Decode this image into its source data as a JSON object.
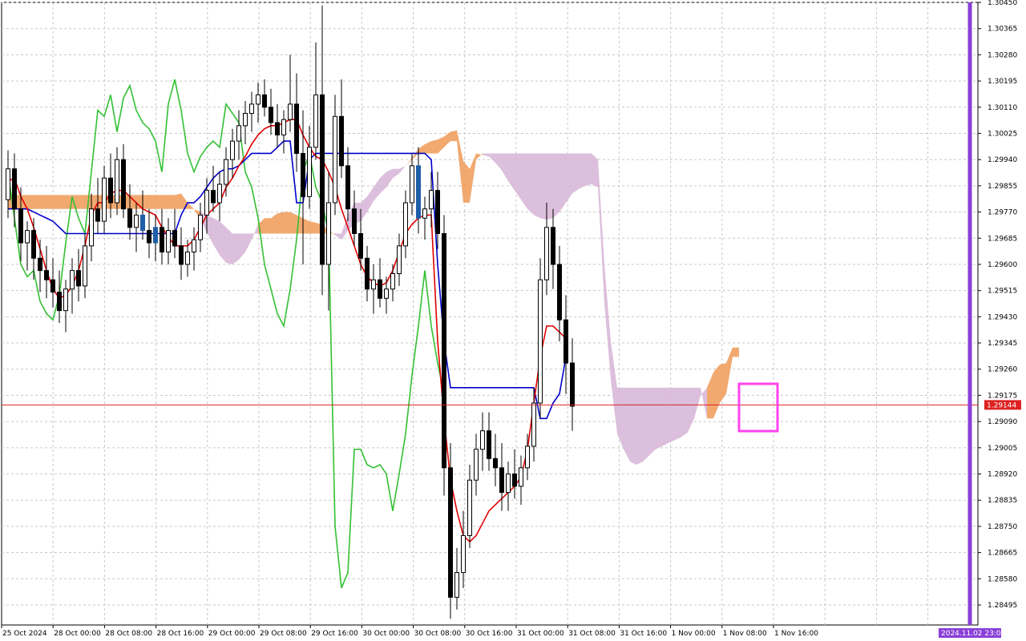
{
  "chart_data": {
    "type": "candlestick",
    "indicator": "ichimoku",
    "ylim": [
      1.2843,
      1.3045
    ],
    "y_ticks": [
      "1.30450",
      "1.30365",
      "1.30280",
      "1.30195",
      "1.30110",
      "1.30025",
      "1.29940",
      "1.29855",
      "1.29770",
      "1.29685",
      "1.29600",
      "1.29515",
      "1.29430",
      "1.29345",
      "1.29260",
      "1.29175",
      "1.29090",
      "1.29005",
      "1.28920",
      "1.28835",
      "1.28750",
      "1.28665",
      "1.28580",
      "1.28495"
    ],
    "x_ticks": [
      "25 Oct 2024",
      "28 Oct 00:00",
      "28 Oct 08:00",
      "28 Oct 16:00",
      "29 Oct 00:00",
      "29 Oct 08:00",
      "29 Oct 16:00",
      "30 Oct 00:00",
      "30 Oct 08:00",
      "30 Oct 16:00",
      "31 Oct 00:00",
      "31 Oct 08:00",
      "31 Oct 16:00",
      "1 Nov 00:00",
      "1 Nov 08:00",
      "1 Nov 16:00"
    ],
    "current_price": 1.29144,
    "current_price_label": "1.29144",
    "time_marker_label": "2024.11.02 23:00",
    "grid": true,
    "colors": {
      "bull_body": "#ffffff",
      "bear_body": "#000000",
      "outline": "#000000",
      "highlight_body": "#1f5ea8",
      "tenkan": "#e00000",
      "kijun": "#0000cc",
      "chikou": "#33c033",
      "cloud_bull": "#f0a060",
      "cloud_bear": "#d8b8d8",
      "price_line": "#dd2222",
      "time_marker": "#8a3fd8",
      "annotation_box": "#ff44ee"
    },
    "candles": [
      {
        "o": 1.2981,
        "h": 1.2997,
        "l": 1.2975,
        "c": 1.2991
      },
      {
        "o": 1.2991,
        "h": 1.2996,
        "l": 1.2972,
        "c": 1.2978
      },
      {
        "o": 1.2978,
        "h": 1.2985,
        "l": 1.2961,
        "c": 1.2967
      },
      {
        "o": 1.2967,
        "h": 1.2974,
        "l": 1.2958,
        "c": 1.2971
      },
      {
        "o": 1.2971,
        "h": 1.2975,
        "l": 1.2955,
        "c": 1.2962
      },
      {
        "o": 1.2962,
        "h": 1.2968,
        "l": 1.2951,
        "c": 1.2958
      },
      {
        "o": 1.2958,
        "h": 1.2966,
        "l": 1.2949,
        "c": 1.2955
      },
      {
        "o": 1.2955,
        "h": 1.2962,
        "l": 1.2946,
        "c": 1.2951
      },
      {
        "o": 1.2951,
        "h": 1.2958,
        "l": 1.2941,
        "c": 1.2945
      },
      {
        "o": 1.2945,
        "h": 1.2955,
        "l": 1.2938,
        "c": 1.2952
      },
      {
        "o": 1.2952,
        "h": 1.2962,
        "l": 1.2944,
        "c": 1.2958
      },
      {
        "o": 1.2958,
        "h": 1.2965,
        "l": 1.2948,
        "c": 1.2953
      },
      {
        "o": 1.2953,
        "h": 1.297,
        "l": 1.2949,
        "c": 1.2966
      },
      {
        "o": 1.2966,
        "h": 1.2983,
        "l": 1.2961,
        "c": 1.2978
      },
      {
        "o": 1.2978,
        "h": 1.2988,
        "l": 1.297,
        "c": 1.2974
      },
      {
        "o": 1.2974,
        "h": 1.2992,
        "l": 1.297,
        "c": 1.2988
      },
      {
        "o": 1.2988,
        "h": 1.2996,
        "l": 1.2975,
        "c": 1.298
      },
      {
        "o": 1.298,
        "h": 1.2998,
        "l": 1.2976,
        "c": 1.2994
      },
      {
        "o": 1.2994,
        "h": 1.2999,
        "l": 1.2975,
        "c": 1.2978
      },
      {
        "o": 1.2978,
        "h": 1.2986,
        "l": 1.2968,
        "c": 1.2972
      },
      {
        "o": 1.2972,
        "h": 1.298,
        "l": 1.2964,
        "c": 1.2976
      },
      {
        "o": 1.2976,
        "h": 1.2984,
        "l": 1.2968,
        "c": 1.2971,
        "hl": 1
      },
      {
        "o": 1.2971,
        "h": 1.2978,
        "l": 1.2962,
        "c": 1.2967
      },
      {
        "o": 1.2967,
        "h": 1.2976,
        "l": 1.2961,
        "c": 1.2972,
        "hl": 1
      },
      {
        "o": 1.2972,
        "h": 1.2978,
        "l": 1.296,
        "c": 1.2964
      },
      {
        "o": 1.2964,
        "h": 1.2975,
        "l": 1.296,
        "c": 1.2971
      },
      {
        "o": 1.2971,
        "h": 1.2978,
        "l": 1.2962,
        "c": 1.2966
      },
      {
        "o": 1.2966,
        "h": 1.2972,
        "l": 1.2955,
        "c": 1.296
      },
      {
        "o": 1.296,
        "h": 1.2968,
        "l": 1.2956,
        "c": 1.2964
      },
      {
        "o": 1.2964,
        "h": 1.2972,
        "l": 1.2958,
        "c": 1.2968
      },
      {
        "o": 1.2968,
        "h": 1.298,
        "l": 1.2964,
        "c": 1.2976
      },
      {
        "o": 1.2976,
        "h": 1.2988,
        "l": 1.297,
        "c": 1.2984
      },
      {
        "o": 1.2984,
        "h": 1.2992,
        "l": 1.2977,
        "c": 1.298
      },
      {
        "o": 1.298,
        "h": 1.299,
        "l": 1.2974,
        "c": 1.2986
      },
      {
        "o": 1.2986,
        "h": 1.2998,
        "l": 1.2982,
        "c": 1.2994
      },
      {
        "o": 1.2994,
        "h": 1.3004,
        "l": 1.2988,
        "c": 1.3
      },
      {
        "o": 1.3,
        "h": 1.301,
        "l": 1.2994,
        "c": 1.3005
      },
      {
        "o": 1.3005,
        "h": 1.3013,
        "l": 1.2999,
        "c": 1.3009
      },
      {
        "o": 1.3009,
        "h": 1.3016,
        "l": 1.3003,
        "c": 1.3012
      },
      {
        "o": 1.3012,
        "h": 1.3019,
        "l": 1.3006,
        "c": 1.3015
      },
      {
        "o": 1.3015,
        "h": 1.302,
        "l": 1.3008,
        "c": 1.3011
      },
      {
        "o": 1.3011,
        "h": 1.3017,
        "l": 1.3002,
        "c": 1.3006
      },
      {
        "o": 1.3006,
        "h": 1.3012,
        "l": 1.2998,
        "c": 1.3002
      },
      {
        "o": 1.3002,
        "h": 1.301,
        "l": 1.2996,
        "c": 1.3007
      },
      {
        "o": 1.3007,
        "h": 1.3028,
        "l": 1.3003,
        "c": 1.3012
      },
      {
        "o": 1.3012,
        "h": 1.3022,
        "l": 1.299,
        "c": 1.2996
      },
      {
        "o": 1.2996,
        "h": 1.301,
        "l": 1.296,
        "c": 1.2982
      },
      {
        "o": 1.2982,
        "h": 1.3005,
        "l": 1.2978,
        "c": 1.2998
      },
      {
        "o": 1.2998,
        "h": 1.3032,
        "l": 1.2994,
        "c": 1.3015
      },
      {
        "o": 1.3015,
        "h": 1.3044,
        "l": 1.295,
        "c": 1.296
      },
      {
        "o": 1.296,
        "h": 1.299,
        "l": 1.2945,
        "c": 1.298
      },
      {
        "o": 1.298,
        "h": 1.3015,
        "l": 1.2976,
        "c": 1.3008
      },
      {
        "o": 1.3008,
        "h": 1.302,
        "l": 1.2988,
        "c": 1.2992
      },
      {
        "o": 1.2992,
        "h": 1.2998,
        "l": 1.2974,
        "c": 1.2978
      },
      {
        "o": 1.2978,
        "h": 1.2984,
        "l": 1.2966,
        "c": 1.297
      },
      {
        "o": 1.297,
        "h": 1.2978,
        "l": 1.2958,
        "c": 1.2962
      },
      {
        "o": 1.2962,
        "h": 1.2966,
        "l": 1.2948,
        "c": 1.2952
      },
      {
        "o": 1.2952,
        "h": 1.296,
        "l": 1.2944,
        "c": 1.2955
      },
      {
        "o": 1.2955,
        "h": 1.2962,
        "l": 1.2946,
        "c": 1.2949
      },
      {
        "o": 1.2949,
        "h": 1.2956,
        "l": 1.2944,
        "c": 1.2952
      },
      {
        "o": 1.2952,
        "h": 1.296,
        "l": 1.2948,
        "c": 1.2957
      },
      {
        "o": 1.2957,
        "h": 1.297,
        "l": 1.2953,
        "c": 1.2966
      },
      {
        "o": 1.2966,
        "h": 1.2984,
        "l": 1.2962,
        "c": 1.298
      },
      {
        "o": 1.298,
        "h": 1.2996,
        "l": 1.2976,
        "c": 1.2992
      },
      {
        "o": 1.2992,
        "h": 1.2998,
        "l": 1.297,
        "c": 1.2975,
        "hl": 1
      },
      {
        "o": 1.2975,
        "h": 1.2982,
        "l": 1.2968,
        "c": 1.2978
      },
      {
        "o": 1.2978,
        "h": 1.299,
        "l": 1.2972,
        "c": 1.2984
      },
      {
        "o": 1.2984,
        "h": 1.299,
        "l": 1.2965,
        "c": 1.297
      },
      {
        "o": 1.297,
        "h": 1.2976,
        "l": 1.2885,
        "c": 1.2894
      },
      {
        "o": 1.2894,
        "h": 1.2902,
        "l": 1.2845,
        "c": 1.2852
      },
      {
        "o": 1.2852,
        "h": 1.2868,
        "l": 1.2848,
        "c": 1.286
      },
      {
        "o": 1.286,
        "h": 1.288,
        "l": 1.2855,
        "c": 1.2872
      },
      {
        "o": 1.2872,
        "h": 1.2895,
        "l": 1.2868,
        "c": 1.289
      },
      {
        "o": 1.289,
        "h": 1.2905,
        "l": 1.2885,
        "c": 1.29
      },
      {
        "o": 1.29,
        "h": 1.2912,
        "l": 1.2893,
        "c": 1.2906
      },
      {
        "o": 1.2906,
        "h": 1.2912,
        "l": 1.2893,
        "c": 1.2897
      },
      {
        "o": 1.2897,
        "h": 1.2905,
        "l": 1.2888,
        "c": 1.2894
      },
      {
        "o": 1.2894,
        "h": 1.2902,
        "l": 1.288,
        "c": 1.2886
      },
      {
        "o": 1.2886,
        "h": 1.2896,
        "l": 1.288,
        "c": 1.2892
      },
      {
        "o": 1.2892,
        "h": 1.29,
        "l": 1.2884,
        "c": 1.2888
      },
      {
        "o": 1.2888,
        "h": 1.2898,
        "l": 1.2882,
        "c": 1.2894
      },
      {
        "o": 1.2894,
        "h": 1.2905,
        "l": 1.289,
        "c": 1.2901
      },
      {
        "o": 1.2901,
        "h": 1.292,
        "l": 1.2896,
        "c": 1.2915
      },
      {
        "o": 1.2915,
        "h": 1.2962,
        "l": 1.291,
        "c": 1.2955
      },
      {
        "o": 1.2955,
        "h": 1.298,
        "l": 1.295,
        "c": 1.2972
      },
      {
        "o": 1.2972,
        "h": 1.2978,
        "l": 1.2952,
        "c": 1.296
      },
      {
        "o": 1.296,
        "h": 1.2966,
        "l": 1.2935,
        "c": 1.2942
      },
      {
        "o": 1.2942,
        "h": 1.295,
        "l": 1.2918,
        "c": 1.2928
      },
      {
        "o": 1.2928,
        "h": 1.2936,
        "l": 1.2906,
        "c": 1.2914
      }
    ],
    "tenkan": [
      1.2987,
      1.2988,
      1.2982,
      1.2978,
      1.2972,
      1.2965,
      1.2958,
      1.2952,
      1.2949,
      1.295,
      1.2953,
      1.2958,
      1.2966,
      1.2976,
      1.298,
      1.298,
      1.2983,
      1.2984,
      1.2984,
      1.2982,
      1.298,
      1.2978,
      1.2977,
      1.2976,
      1.2972,
      1.2969,
      1.2966,
      1.2966,
      1.2966,
      1.2968,
      1.2972,
      1.2976,
      1.2978,
      1.298,
      1.2985,
      1.2988,
      1.2992,
      1.2995,
      1.2999,
      1.3002,
      1.3004,
      1.3005,
      1.3005,
      1.3006,
      1.3007,
      1.3007,
      1.3002,
      1.2998,
      1.2995,
      1.2994,
      1.299,
      1.2985,
      1.2978,
      1.2972,
      1.2966,
      1.296,
      1.2956,
      1.2954,
      1.2953,
      1.2954,
      1.2958,
      1.2964,
      1.297,
      1.2973,
      1.2975,
      1.2976,
      1.2976,
      1.2935,
      1.291,
      1.289,
      1.288,
      1.2872,
      1.287,
      1.2872,
      1.2876,
      1.288,
      1.2882,
      1.2884,
      1.2886,
      1.2888,
      1.2891,
      1.29,
      1.2915,
      1.293,
      1.294,
      1.294,
      1.2938,
      1.2936
    ],
    "kijun": [
      1.2978,
      1.2978,
      1.2978,
      1.2978,
      1.2977,
      1.2976,
      1.2975,
      1.2974,
      1.2972,
      1.297,
      1.297,
      1.297,
      1.297,
      1.297,
      1.297,
      1.297,
      1.297,
      1.297,
      1.297,
      1.297,
      1.297,
      1.297,
      1.297,
      1.297,
      1.297,
      1.297,
      1.297,
      1.2976,
      1.298,
      1.298,
      1.2982,
      1.2985,
      1.2988,
      1.299,
      1.2991,
      1.2991,
      1.2992,
      1.2994,
      1.2996,
      1.2996,
      1.2996,
      1.2996,
      1.2998,
      1.3,
      1.3,
      1.298,
      1.298,
      1.2994,
      1.2996,
      1.2996,
      1.2996,
      1.2996,
      1.2996,
      1.2996,
      1.2996,
      1.2996,
      1.2996,
      1.2996,
      1.2996,
      1.2996,
      1.2996,
      1.2996,
      1.2996,
      1.2996,
      1.2996,
      1.2996,
      1.2994,
      1.296,
      1.2935,
      1.292,
      1.292,
      1.292,
      1.292,
      1.292,
      1.292,
      1.292,
      1.292,
      1.292,
      1.292,
      1.292,
      1.292,
      1.292,
      1.292,
      1.291,
      1.291,
      1.2915,
      1.2918,
      1.293
    ],
    "chikou": [
      1.299,
      1.2975,
      1.296,
      1.2956,
      1.2958,
      1.2948,
      1.2944,
      1.2942,
      1.295,
      1.2967,
      1.2982,
      1.2975,
      1.297,
      1.299,
      1.301,
      1.3008,
      1.3015,
      1.3003,
      1.3014,
      1.3018,
      1.301,
      1.3006,
      1.3004,
      1.3,
      1.299,
      1.3012,
      1.302,
      1.301,
      1.2996,
      1.299,
      1.2995,
      1.2998,
      1.3,
      1.2998,
      1.3012,
      1.3009,
      1.3006,
      1.299,
      1.2985,
      1.2975,
      1.296,
      1.2952,
      1.2944,
      1.294,
      1.2952,
      1.2968,
      1.299,
      1.2996,
      1.2985,
      1.298,
      1.297,
      1.2875,
      1.2855,
      1.286,
      1.29,
      1.29,
      1.2895,
      1.2894,
      1.2895,
      1.2892,
      1.288,
      1.2892,
      1.2905,
      1.2924,
      1.294,
      1.2958,
      1.294,
      1.2928,
      1.2918
    ]
  }
}
